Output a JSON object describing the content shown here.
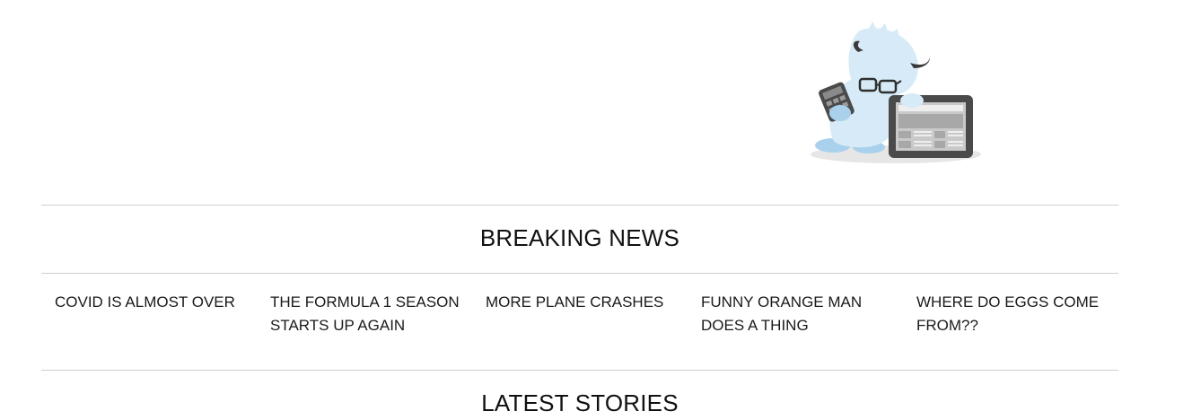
{
  "hero": {
    "illustration": "yeti-mascot-with-tablet-and-calculator-icon"
  },
  "breaking_news": {
    "heading": "BREAKING NEWS",
    "items": [
      {
        "title": "COVID IS ALMOST OVER"
      },
      {
        "title": "THE FORMULA 1 SEASON STARTS UP AGAIN"
      },
      {
        "title": "MORE PLANE CRASHES"
      },
      {
        "title": "FUNNY ORANGE MAN DOES A THING"
      },
      {
        "title": "WHERE DO EGGS COME FROM??"
      }
    ]
  },
  "latest_stories": {
    "heading": "LATEST STORIES"
  },
  "colors": {
    "rule": "#cfcfcf",
    "text": "#1a1a1a",
    "mascot_fur": "#d6ebf7",
    "mascot_shade": "#a9d1ec",
    "device_dark": "#4a4a4a"
  }
}
